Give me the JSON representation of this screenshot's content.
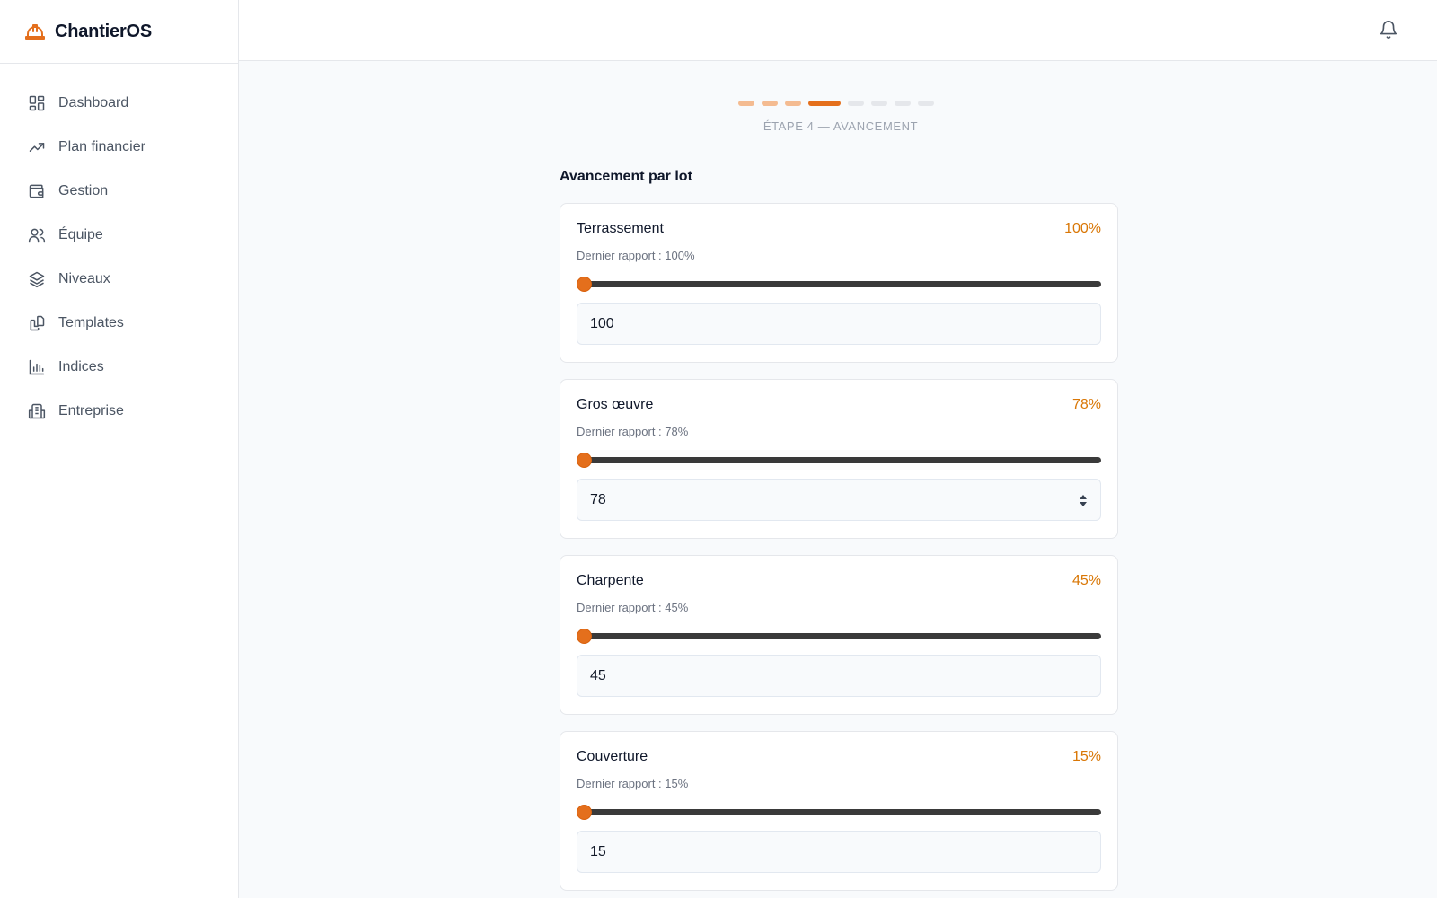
{
  "brand": {
    "name": "ChantierOS",
    "color": "#e46f1c"
  },
  "sidebar": {
    "items": [
      {
        "label": "Dashboard",
        "icon": "dashboard-grid-icon"
      },
      {
        "label": "Plan financier",
        "icon": "trending-up-icon"
      },
      {
        "label": "Gestion",
        "icon": "wallet-icon"
      },
      {
        "label": "Équipe",
        "icon": "users-icon"
      },
      {
        "label": "Niveaux",
        "icon": "layers-icon"
      },
      {
        "label": "Templates",
        "icon": "copy-icon"
      },
      {
        "label": "Indices",
        "icon": "bar-chart-icon"
      },
      {
        "label": "Entreprise",
        "icon": "building-icon"
      }
    ]
  },
  "topbar": {
    "notification_icon": "bell-icon"
  },
  "stepper": {
    "total_steps": 8,
    "current_step": 4,
    "caption": "ÉTAPE 4 — AVANCEMENT"
  },
  "section": {
    "title": "Avancement par lot"
  },
  "lots": [
    {
      "name": "Terrassement",
      "percent_label": "100%",
      "report": "Dernier rapport : 100%",
      "value": "100",
      "progress": 100
    },
    {
      "name": "Gros œuvre",
      "percent_label": "78%",
      "report": "Dernier rapport : 78%",
      "value": "78",
      "progress": 78
    },
    {
      "name": "Charpente",
      "percent_label": "45%",
      "report": "Dernier rapport : 45%",
      "value": "45",
      "progress": 45
    },
    {
      "name": "Couverture",
      "percent_label": "15%",
      "report": "Dernier rapport : 15%",
      "value": "15",
      "progress": 15
    }
  ],
  "colors": {
    "accent": "#e46f1c",
    "percent_text": "#d97706",
    "track": "#3a3a3a"
  }
}
